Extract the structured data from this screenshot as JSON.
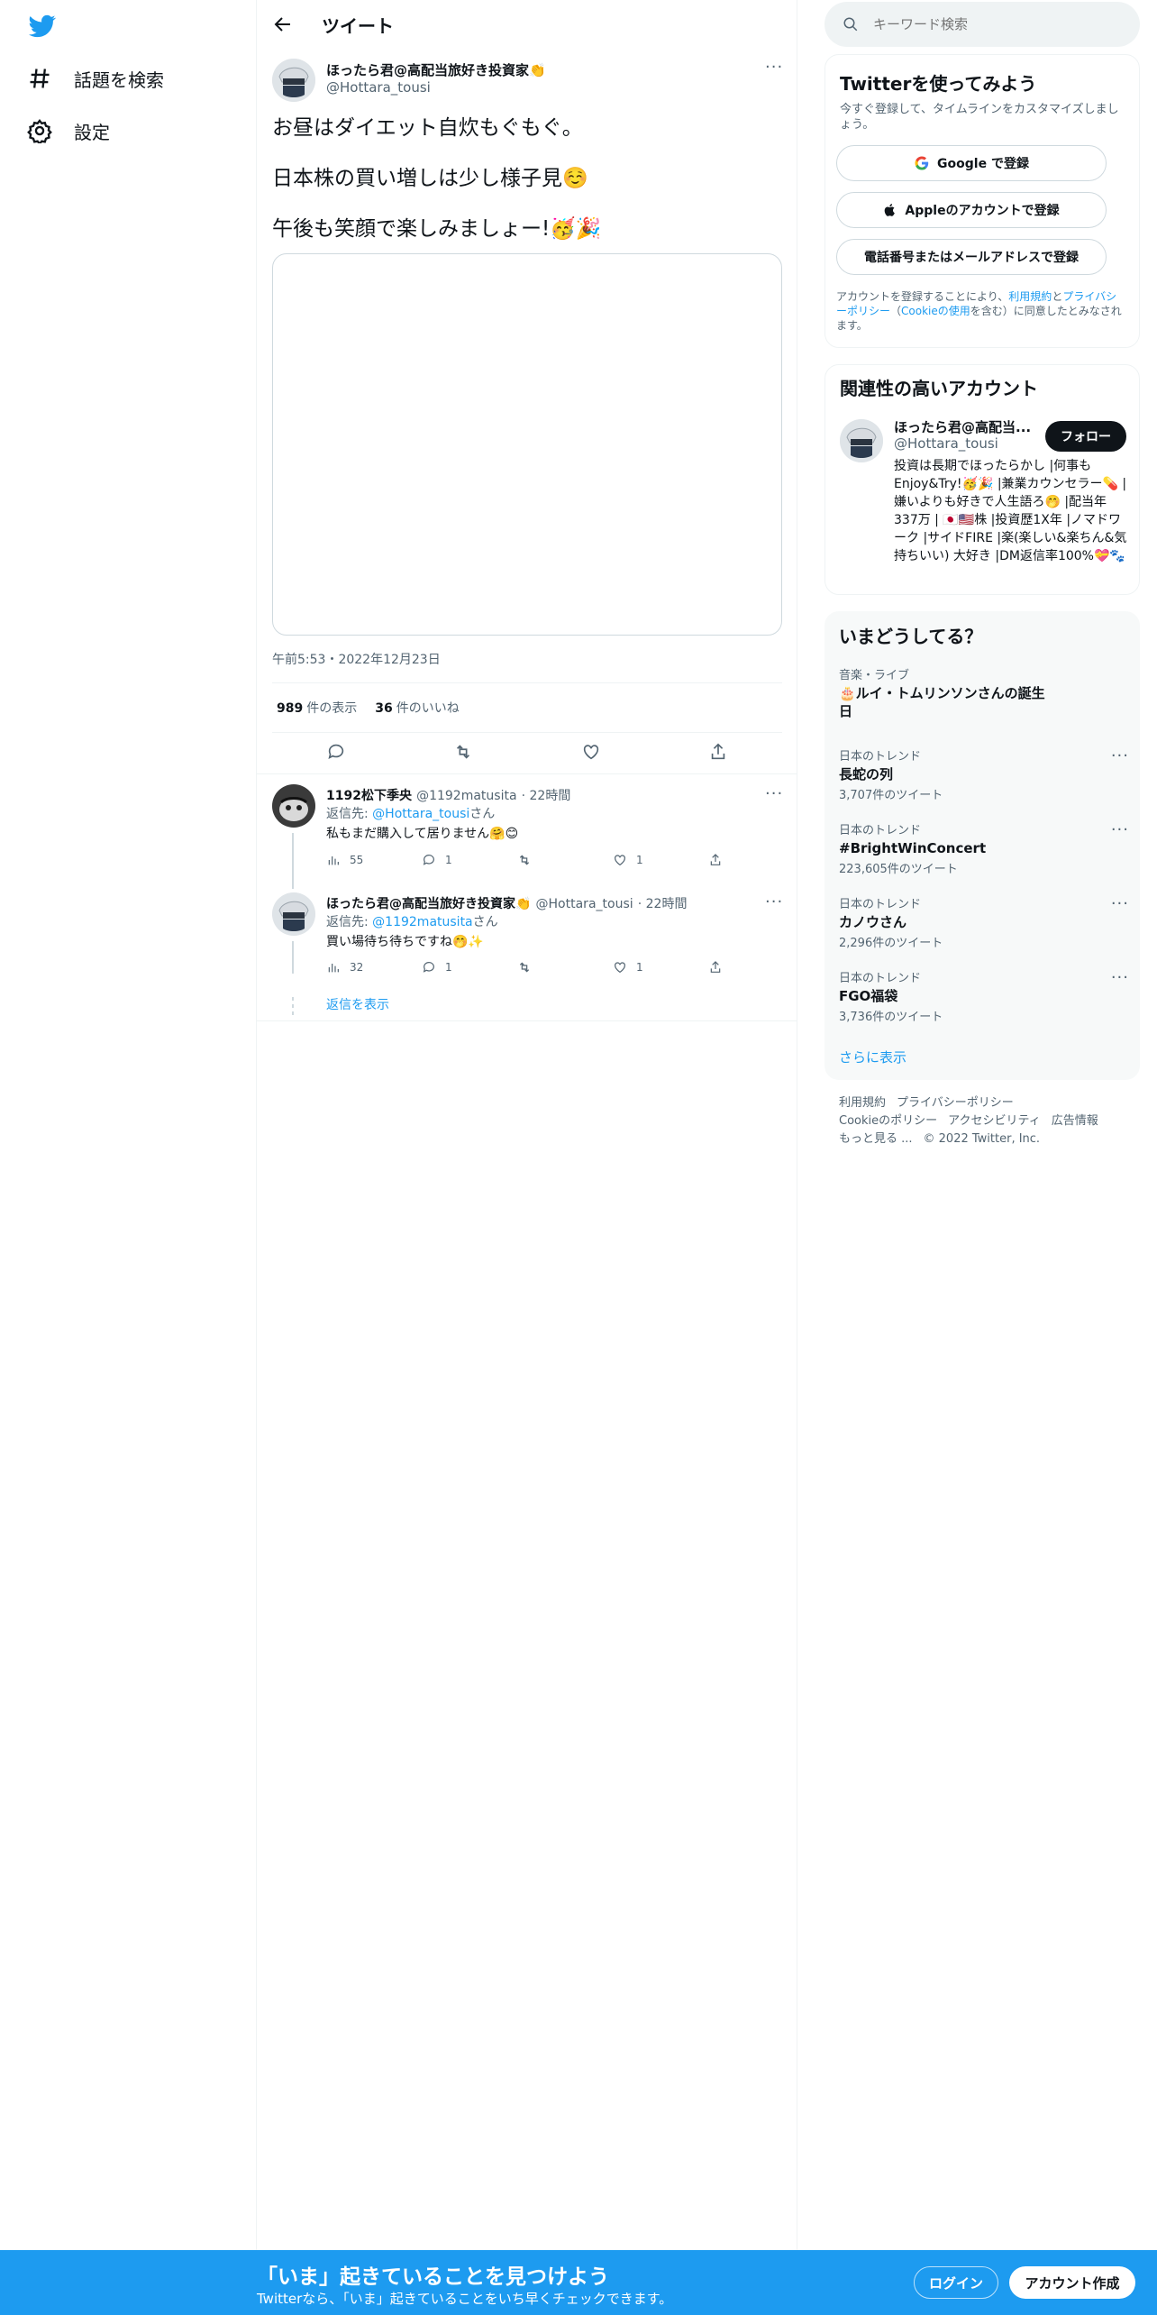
{
  "nav": {
    "items": [
      {
        "label": "話題を検索",
        "icon": "hashtag-icon"
      },
      {
        "label": "設定",
        "icon": "gear-icon"
      }
    ]
  },
  "header": {
    "title": "ツイート"
  },
  "tweet": {
    "author_name": "ほったら君@高配当旅好き投資家👏",
    "author_handle": "@Hottara_tousi",
    "lines": [
      "お昼はダイエット自炊もぐもぐ。",
      "日本株の買い増しは少し様子見☺️",
      "午後も笑顔で楽しみましょー!🥳🎉"
    ],
    "timestamp": "午前5:53・2022年12月23日",
    "views_count": "989",
    "views_label": "件の表示",
    "likes_count": "36",
    "likes_label": "件のいいね"
  },
  "replies": [
    {
      "name": "1192松下季央",
      "handle": "@1192matusita",
      "time": "· 22時間",
      "reply_prefix": "返信先: ",
      "reply_to": "@Hottara_tousi",
      "reply_suffix": "さん",
      "text": "私もまだ購入して居りません🤗😊",
      "views": "55",
      "replies": "1",
      "retweets": "",
      "likes": "1"
    },
    {
      "name": "ほったら君@高配当旅好き投資家👏",
      "handle": "@Hottara_tousi",
      "time": "· 22時間",
      "reply_prefix": "返信先: ",
      "reply_to": "@1192matusita",
      "reply_suffix": "さん",
      "text": "買い場待ち待ちですね🤭✨",
      "views": "32",
      "replies": "1",
      "retweets": "",
      "likes": "1"
    }
  ],
  "show_replies": "返信を表示",
  "search": {
    "placeholder": "キーワード検索"
  },
  "signup": {
    "title": "Twitterを使ってみよう",
    "subtitle": "今すぐ登録して、タイムラインをカスタマイズしましょう。",
    "google": "Google で登録",
    "apple": "Appleのアカウントで登録",
    "phone": "電話番号またはメールアドレスで登録",
    "legal_1": "アカウントを登録することにより、",
    "legal_terms": "利用規約",
    "legal_2": "と",
    "legal_privacy": "プライバシーポリシー",
    "legal_3": "（",
    "legal_cookie": "Cookieの使用",
    "legal_4": "を含む）に同意したとみなされます。"
  },
  "related": {
    "title": "関連性の高いアカウント",
    "name": "ほったら君@高配当...",
    "handle": "@Hottara_tousi",
    "follow": "フォロー",
    "bio": "投資は長期でほったらかし |何事もEnjoy&Try!🥳🎉 |兼業カウンセラー💊 |嫌いよりも好きで人生語ろ🤭 |配当年337万 | 🇯🇵🇺🇸株 |投資歴1X年 |ノマドワーク |サイドFIRE |楽(楽しい&楽ちん&気持ちいい) 大好き |DM返信率100%💝🐾"
  },
  "trends": {
    "title": "いまどうしてる？",
    "items": [
      {
        "category": "音楽・ライブ",
        "name": "🎂ルイ・トムリンソンさんの誕生日",
        "count": ""
      },
      {
        "category": "日本のトレンド",
        "name": "長蛇の列",
        "count": "3,707件のツイート"
      },
      {
        "category": "日本のトレンド",
        "name": "#BrightWinConcert",
        "count": "223,605件のツイート"
      },
      {
        "category": "日本のトレンド",
        "name": "カノウさん",
        "count": "2,296件のツイート"
      },
      {
        "category": "日本のトレンド",
        "name": "FGO福袋",
        "count": "3,736件のツイート"
      }
    ],
    "show_more": "さらに表示"
  },
  "footer": {
    "links": [
      "利用規約",
      "プライバシーポリシー",
      "Cookieのポリシー",
      "アクセシビリティ",
      "広告情報",
      "もっと見る ..."
    ],
    "copyright": "© 2022 Twitter, Inc."
  },
  "bottom": {
    "title": "「いま」起きていることを見つけよう",
    "subtitle": "Twitterなら、「いま」起きていることをいち早くチェックできます。",
    "login": "ログイン",
    "signup": "アカウント作成"
  },
  "colors": {
    "accent": "#1d9bf0",
    "text": "#0f1419",
    "muted": "#536471",
    "border": "#eff3f4"
  }
}
